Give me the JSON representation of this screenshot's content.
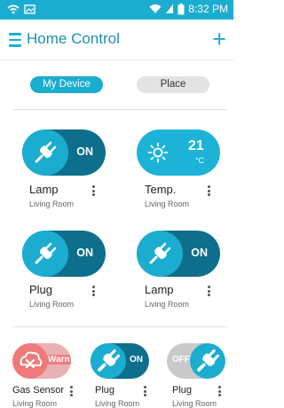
{
  "status": {
    "time": "8:32 PM"
  },
  "header": {
    "title": "Home Control",
    "add_label": "+"
  },
  "tabs": {
    "my_device": "My Device",
    "place": "Place"
  },
  "devices": [
    {
      "name": "Lamp",
      "room": "Living Room",
      "state": "ON",
      "icon": "plug-icon"
    },
    {
      "name": "Temp.",
      "room": "Living Room",
      "value": "21",
      "unit": "°C",
      "icon": "sun-icon"
    },
    {
      "name": "Plug",
      "room": "Living Room",
      "state": "ON",
      "icon": "plug-icon"
    },
    {
      "name": "Lamp",
      "room": "Living Room",
      "state": "ON",
      "icon": "plug-icon"
    },
    {
      "name": "Gas Sensor",
      "room": "Living Room",
      "state": "Warn",
      "icon": "gas-alert-icon"
    },
    {
      "name": "Plug",
      "room": "Living Room",
      "state": "ON",
      "icon": "plug-icon"
    },
    {
      "name": "Plug",
      "room": "Living Room",
      "state": "OFF",
      "icon": "plug-icon"
    }
  ],
  "colors": {
    "accent": "#1badd0",
    "dark_accent": "#0e6f8c",
    "warn": "#f07a7a",
    "warn_dark": "#e8b2b2",
    "off_gray": "#c9c9c9"
  }
}
